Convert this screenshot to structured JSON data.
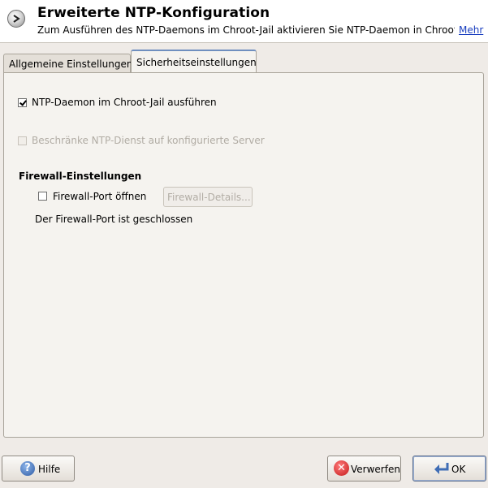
{
  "header": {
    "title": "Erweiterte NTP-Konfiguration",
    "subtitle": "Zum Ausführen des NTP-Daemons im Chroot-Jail aktivieren Sie NTP-Daemon in Chroot…",
    "more_link": "Mehr",
    "icon": "clock-arrow-icon"
  },
  "tabs": [
    {
      "label": "Allgemeine Einstellungen",
      "active": false
    },
    {
      "label": "Sicherheitseinstellungen",
      "active": true
    }
  ],
  "security": {
    "chroot_checkbox": {
      "label": "NTP-Daemon im Chroot-Jail ausführen",
      "checked": true,
      "enabled": true
    },
    "restrict_checkbox": {
      "label": "Beschränke NTP-Dienst auf konfigurierte Server",
      "checked": false,
      "enabled": false
    },
    "firewall": {
      "section_title": "Firewall-Einstellungen",
      "open_port_label": "Firewall-Port öffnen",
      "open_port_checked": false,
      "details_button": "Firewall-Details...",
      "status_text": "Der Firewall-Port ist geschlossen"
    }
  },
  "footer": {
    "help_button": "Hilfe",
    "cancel_button": "Verwerfen",
    "ok_button": "OK"
  },
  "colors": {
    "background": "#efebe7",
    "link": "#1a3fbf",
    "cancel_icon": "#c41a1a",
    "help_icon": "#2c5aa4"
  }
}
